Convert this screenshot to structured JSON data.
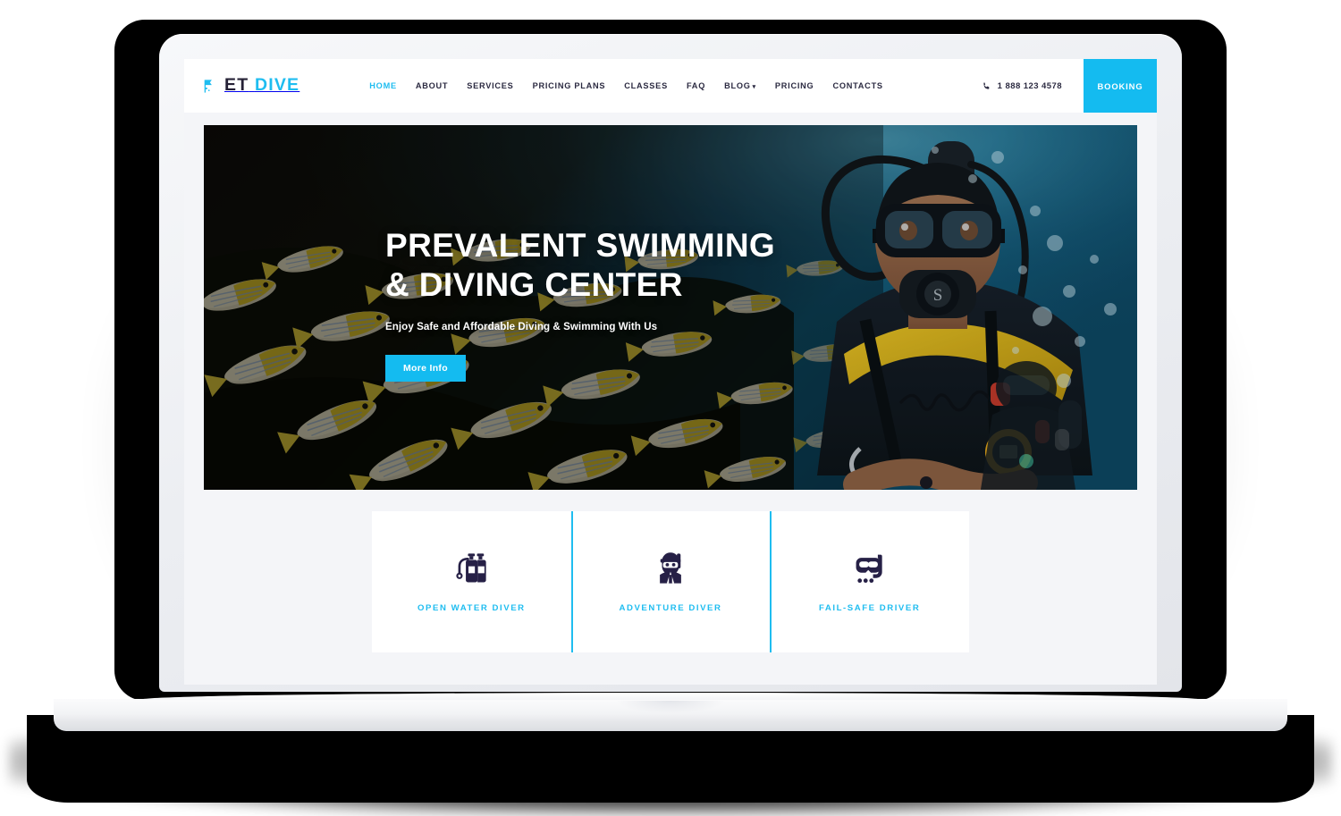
{
  "header": {
    "brand": {
      "icon": "dive-flag-icon",
      "name_primary": "ET",
      "name_secondary": "DIVE"
    },
    "nav": [
      {
        "label": "HOME",
        "active": true,
        "has_caret": false
      },
      {
        "label": "ABOUT",
        "active": false,
        "has_caret": false
      },
      {
        "label": "SERVICES",
        "active": false,
        "has_caret": false
      },
      {
        "label": "PRICING PLANS",
        "active": false,
        "has_caret": false
      },
      {
        "label": "CLASSES",
        "active": false,
        "has_caret": false
      },
      {
        "label": "FAQ",
        "active": false,
        "has_caret": false
      },
      {
        "label": "BLOG",
        "active": false,
        "has_caret": true
      },
      {
        "label": "PRICING",
        "active": false,
        "has_caret": false
      },
      {
        "label": "CONTACTS",
        "active": false,
        "has_caret": false
      }
    ],
    "phone": {
      "icon": "phone-icon",
      "number": "1 888 123 4578"
    },
    "booking_label": "BOOKING"
  },
  "hero": {
    "title_line1": "PREVALENT SWIMMING",
    "title_line2": "& DIVING CENTER",
    "subtitle": "Enjoy Safe and Affordable Diving & Swimming With Us",
    "cta_label": "More Info",
    "image_alt": "Scuba diver underwater beside a school of yellow bluestripe snapper fish"
  },
  "features": [
    {
      "icon": "scuba-tanks-icon",
      "label": "OPEN WATER DIVER"
    },
    {
      "icon": "diver-person-icon",
      "label": "ADVENTURE DIVER"
    },
    {
      "icon": "dive-mask-icon",
      "label": "FAIL-SAFE DRIVER"
    }
  ],
  "colors": {
    "accent": "#14bbf0",
    "accent_light": "#1fbdf0",
    "ink": "#2b2a41",
    "icon_navy": "#262046",
    "page_bg": "#f4f5f8",
    "surface": "#ffffff"
  }
}
